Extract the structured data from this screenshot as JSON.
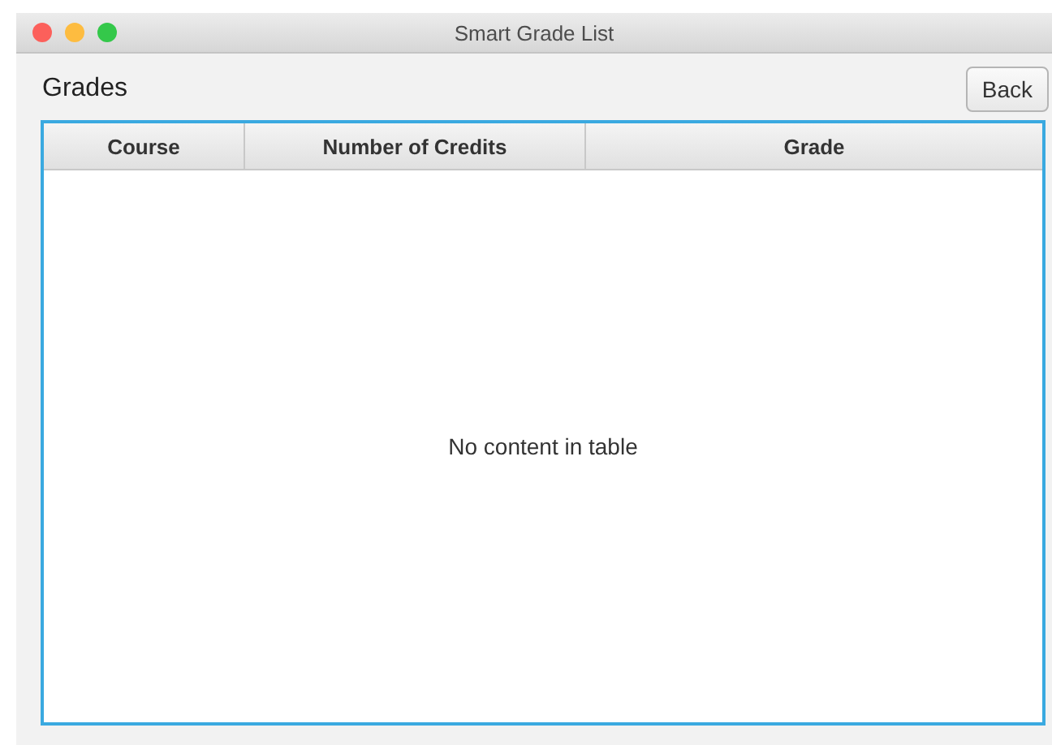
{
  "window": {
    "title": "Smart Grade List"
  },
  "heading": "Grades",
  "back_button": "Back",
  "table": {
    "columns": [
      "Course",
      "Number of Credits",
      "Grade"
    ],
    "placeholder": "No content in table"
  }
}
